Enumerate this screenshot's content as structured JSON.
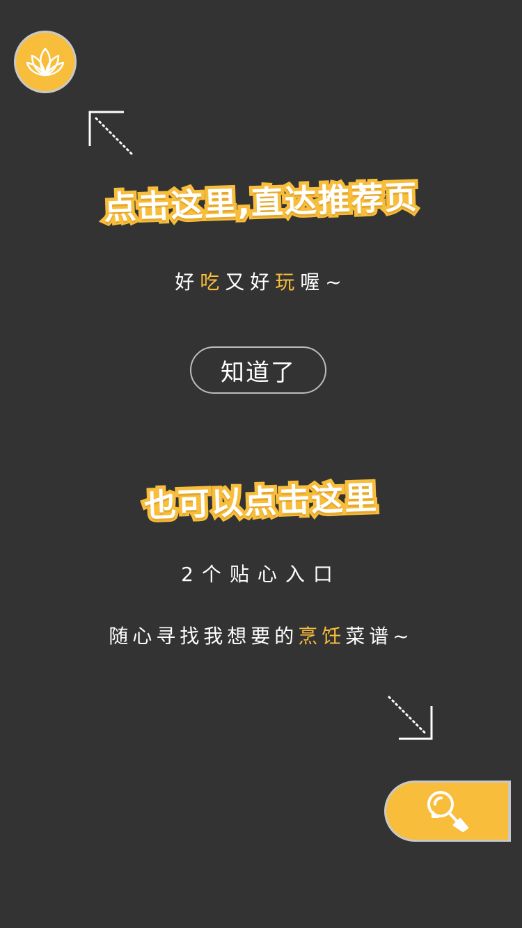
{
  "guide": {
    "headline_top": "点击这里,直达推荐页",
    "sub_top": {
      "p1": "好",
      "p2": "吃",
      "p3": "又好",
      "p4": "玩",
      "p5": "喔~"
    },
    "got_it_label": "知道了",
    "headline_bottom": "也可以点击这里",
    "sub_mid": "2个贴心入口",
    "sub_bottom": {
      "p1": "随心寻找我想要的",
      "p2": "烹饪",
      "p3": "菜谱~"
    }
  },
  "colors": {
    "background": "#333333",
    "accent": "#f8bd3b",
    "border": "#c9c9c9",
    "text": "#ffffff"
  },
  "icons": {
    "logo": "lotus-icon",
    "tip": "lightbulb-icon",
    "arrow_top": "arrow-up-left-icon",
    "arrow_bottom": "arrow-down-right-icon"
  }
}
